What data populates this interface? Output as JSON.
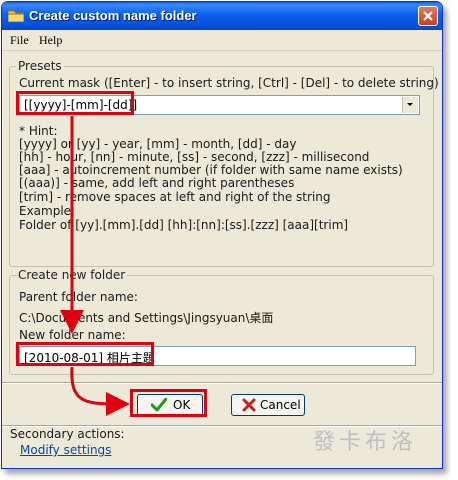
{
  "window": {
    "title": "Create custom name folder"
  },
  "menu": {
    "file": "File",
    "help": "Help"
  },
  "presets": {
    "legend": "Presets",
    "mask_label": "Current mask  ([Enter] - to insert string, [Ctrl] - [Del] - to delete string)",
    "mask_value": "[[yyyy]-[mm]-[dd]]",
    "hint_lines": [
      "* Hint:",
      "[yyyy] or [yy] - year, [mm] - month, [dd] - day",
      "[hh] - hour, [nn] - minute, [ss] - second, [zzz] - millisecond",
      "[aaa] - autoincrement number (if folder with same name exists)",
      "[(aaa)] - same, add left and right parentheses",
      "[trim] - remove spaces at left and right of the string",
      "Example:",
      "Folder of [yy].[mm].[dd] [hh]:[nn]:[ss].[zzz] [aaa][trim]"
    ]
  },
  "new_folder": {
    "legend": "Create new folder",
    "parent_label": "Parent folder name:",
    "parent_value": "C:\\Documents and Settings\\Jingsyuan\\桌面",
    "name_label": "New folder name:",
    "name_value": "[2010-08-01] 相片主題"
  },
  "buttons": {
    "ok": "OK",
    "cancel": "Cancel"
  },
  "secondary": {
    "label": "Secondary actions:",
    "modify": "Modify settings"
  },
  "watermark": "發卡布洛",
  "colors": {
    "highlight": "#e00010",
    "title_blue": "#0250d8",
    "ok_check": "#1a9a1a",
    "cancel_x": "#c81e1e"
  }
}
